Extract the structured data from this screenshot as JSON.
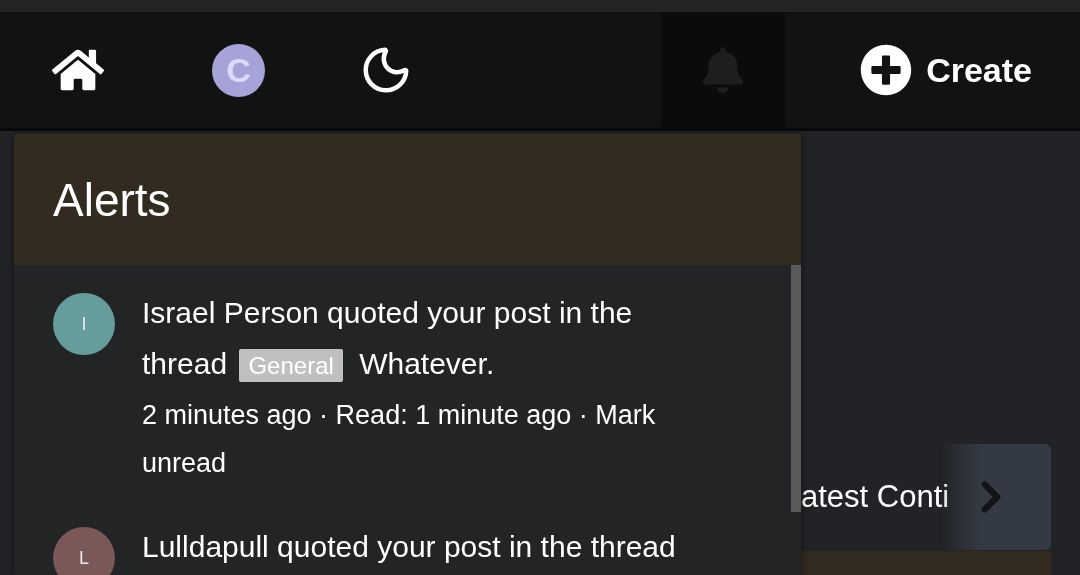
{
  "nav": {
    "avatar_letter": "C",
    "alerts_open": true,
    "create_label": "Create"
  },
  "alerts": {
    "title": "Alerts",
    "items": [
      {
        "letter": "I",
        "color": "#669c9c",
        "text": "Israel Person quoted your post in the thread",
        "tag": "General",
        "thread": "Whatever.",
        "meta": "2 minutes ago · Read: 1 minute ago · Mark unread"
      },
      {
        "letter": "L",
        "color": "#7a5858",
        "text": "Lulldapull quoted your post in the thread"
      }
    ]
  },
  "background_tab": {
    "label": "atest Conti"
  }
}
